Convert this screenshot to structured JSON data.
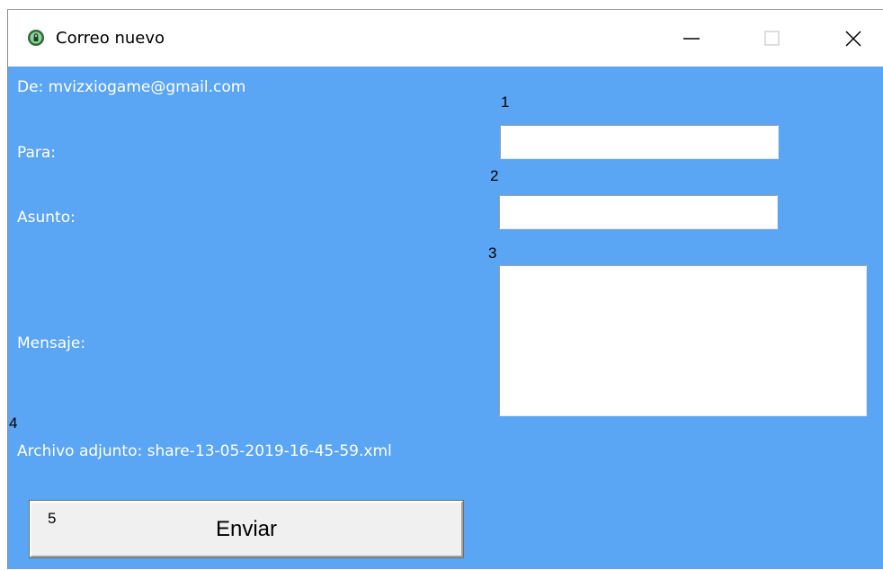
{
  "window": {
    "title": "Correo nuevo",
    "icon": "app-icon",
    "controls": {
      "minimize": "minimize-icon",
      "maximize": "maximize-icon",
      "close": "close-icon"
    }
  },
  "colors": {
    "background": "#5ba5f5",
    "label": "#ffffff",
    "field": "#ffffff",
    "button": "#f0f0f0"
  },
  "form": {
    "from": "De: mvizxiogame@gmail.com",
    "to_label": "Para:",
    "subject_label": "Asunto:",
    "message_label": "Mensaje:",
    "attachment": "Archivo adjunto: share-13-05-2019-16-45-59.xml",
    "to_value": "",
    "subject_value": "",
    "message_value": "",
    "markers": {
      "to": "1",
      "subject": "2",
      "message": "3",
      "attachment": "4",
      "send": "5"
    },
    "send_label": "Enviar"
  }
}
